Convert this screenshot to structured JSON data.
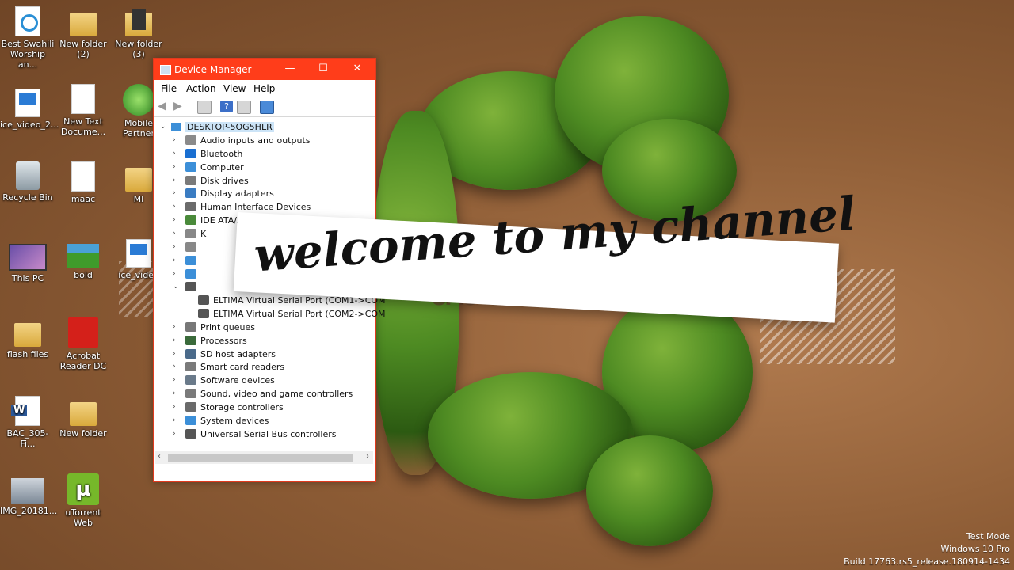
{
  "desktop_icons": [
    {
      "label": "Best Swahili Worship an...",
      "kind": "swahili"
    },
    {
      "label": "New folder (2)",
      "kind": "folder"
    },
    {
      "label": "New folder (3)",
      "kind": "folder3"
    },
    {
      "label": "ice_video_2...",
      "kind": "video"
    },
    {
      "label": "New Text Docume...",
      "kind": "txt"
    },
    {
      "label": "Mobile Partner",
      "kind": "mobile"
    },
    {
      "label": "Recycle Bin",
      "kind": "bin"
    },
    {
      "label": "maac",
      "kind": "txt"
    },
    {
      "label": "MI",
      "kind": "folder"
    },
    {
      "label": "This PC",
      "kind": "pc"
    },
    {
      "label": "bold",
      "kind": "game"
    },
    {
      "label": "ice_video",
      "kind": "video"
    },
    {
      "label": "flash files",
      "kind": "folder"
    },
    {
      "label": "Acrobat Reader DC",
      "kind": "pdf"
    },
    {
      "label": "BAC_305-Fi...",
      "kind": "word"
    },
    {
      "label": "New folder",
      "kind": "folder"
    },
    {
      "label": "IMG_20181...",
      "kind": "photo"
    },
    {
      "label": "uTorrent Web",
      "kind": "utorrent"
    }
  ],
  "window": {
    "title": "Device Manager",
    "controls": {
      "minimize": "—",
      "maximize": "☐",
      "close": "✕"
    },
    "menu": [
      "File",
      "Action",
      "View",
      "Help"
    ],
    "root": "DESKTOP-5OG5HLR",
    "tree": [
      {
        "label": "Audio inputs and outputs",
        "icon_color": "#8a8a8a",
        "chevron": "›"
      },
      {
        "label": "Bluetooth",
        "icon_color": "#1a6fd1",
        "chevron": "›"
      },
      {
        "label": "Computer",
        "icon_color": "#3c8fd8",
        "chevron": "›"
      },
      {
        "label": "Disk drives",
        "icon_color": "#7a7a7a",
        "chevron": "›"
      },
      {
        "label": "Display adapters",
        "icon_color": "#3a7cc2",
        "chevron": "›"
      },
      {
        "label": "Human Interface Devices",
        "icon_color": "#6b6b6b",
        "chevron": "›"
      },
      {
        "label": "IDE ATA/ATAPI",
        "icon_color": "#4a8a3a",
        "chevron": "›"
      },
      {
        "label": "K",
        "icon_color": "#888888",
        "chevron": "›"
      },
      {
        "label": "",
        "icon_color": "#888888",
        "chevron": "›"
      },
      {
        "label": "",
        "icon_color": "#3c8fd8",
        "chevron": "›"
      },
      {
        "label": "",
        "icon_color": "#3c8fd8",
        "chevron": "›"
      },
      {
        "label": "",
        "icon_color": "#555555",
        "chevron": "⌄"
      },
      {
        "label": "ELTIMA Virtual Serial Port (COM1->COM",
        "icon_color": "#555555",
        "chevron": "",
        "child": true
      },
      {
        "label": "ELTIMA Virtual Serial Port (COM2->COM",
        "icon_color": "#555555",
        "chevron": "",
        "child": true
      },
      {
        "label": "Print queues",
        "icon_color": "#777777",
        "chevron": "›"
      },
      {
        "label": "Processors",
        "icon_color": "#3a6a3a",
        "chevron": "›"
      },
      {
        "label": "SD host adapters",
        "icon_color": "#4a6a8a",
        "chevron": "›"
      },
      {
        "label": "Smart card readers",
        "icon_color": "#7a7a7a",
        "chevron": "›"
      },
      {
        "label": "Software devices",
        "icon_color": "#6a7a8a",
        "chevron": "›"
      },
      {
        "label": "Sound, video and game controllers",
        "icon_color": "#7a7a7a",
        "chevron": "›"
      },
      {
        "label": "Storage controllers",
        "icon_color": "#6a6a6a",
        "chevron": "›"
      },
      {
        "label": "System devices",
        "icon_color": "#3c8fd8",
        "chevron": "›"
      },
      {
        "label": "Universal Serial Bus controllers",
        "icon_color": "#555555",
        "chevron": "›"
      }
    ]
  },
  "banner": {
    "text": "welcome to my channel"
  },
  "wallpaper": {
    "text": "ubuntu"
  },
  "watermark": {
    "line1": "Test Mode",
    "line2": "Windows 10 Pro",
    "line3": "Build 17763.rs5_release.180914-1434"
  },
  "colors": {
    "titlebar": "#ff3d1a",
    "selection_blue": "#1a6fd1"
  }
}
